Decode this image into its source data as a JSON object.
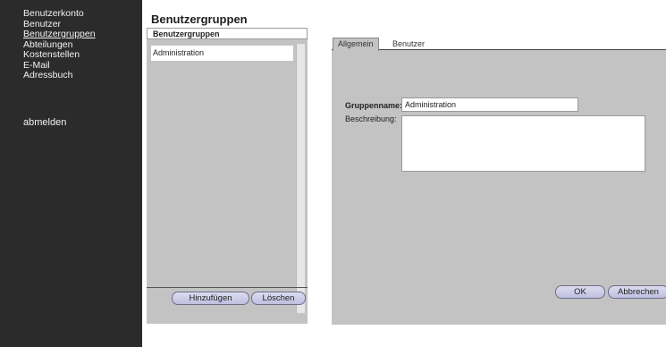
{
  "sidebar": {
    "items": [
      {
        "label": "Benutzerkonto",
        "active": false
      },
      {
        "label": "Benutzer",
        "active": false
      },
      {
        "label": "Benutzergruppen",
        "active": true
      },
      {
        "label": "Abteilungen",
        "active": false
      },
      {
        "label": "Kostenstellen",
        "active": false
      },
      {
        "label": "E-Mail",
        "active": false
      },
      {
        "label": "Adressbuch",
        "active": false
      }
    ],
    "logout": "abmelden"
  },
  "page_title": "Benutzergruppen",
  "list": {
    "header": "Benutzergruppen",
    "rows": [
      "Administration"
    ],
    "add_label": "Hinzufügen",
    "delete_label": "Löschen"
  },
  "detail": {
    "tabs": [
      {
        "label": "Allgemein",
        "active": true
      },
      {
        "label": "Benutzer",
        "active": false
      }
    ],
    "name_label": "Gruppenname:",
    "name_value": "Administration",
    "description_label": "Beschreibung:",
    "description_value": "",
    "ok_label": "OK",
    "cancel_label": "Abbrechen"
  }
}
